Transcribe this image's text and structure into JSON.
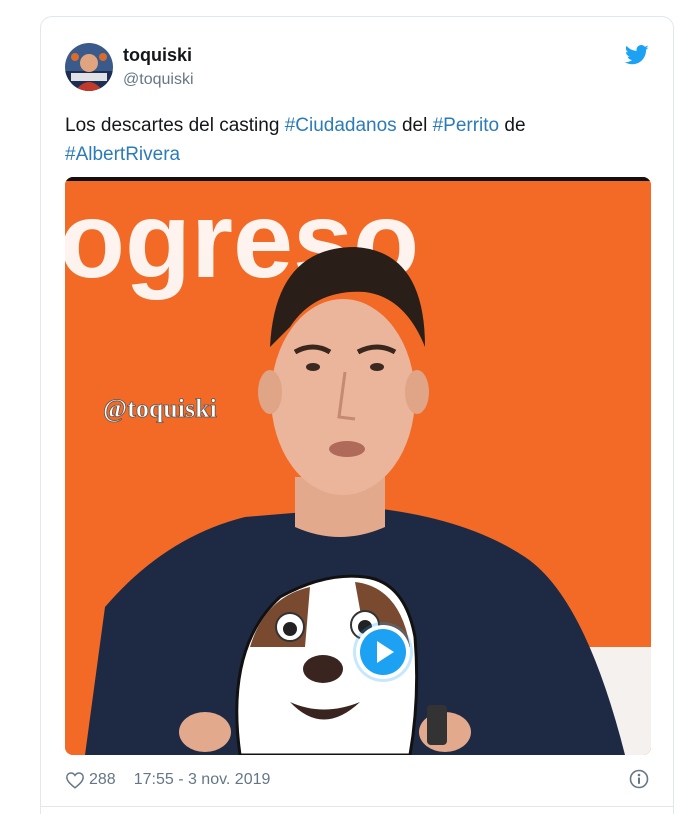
{
  "tweet": {
    "author_name": "toquiski",
    "author_handle": "@toquiski",
    "text_parts": [
      {
        "text": "Los descartes del casting ",
        "hashtag": false
      },
      {
        "text": "#Ciudadanos",
        "hashtag": true
      },
      {
        "text": " del ",
        "hashtag": false
      },
      {
        "text": "#Perrito",
        "hashtag": true
      },
      {
        "text": " de ",
        "hashtag": false
      },
      {
        "text": "#AlbertRivera",
        "hashtag": true
      }
    ],
    "media": {
      "overlay_top_text": "ogreso",
      "watermark": "@toquiski",
      "play_icon": "play-icon"
    },
    "likes": "288",
    "timestamp": "17:55 - 3 nov. 2019"
  },
  "icons": {
    "brand": "twitter-bird-icon",
    "like": "heart-icon",
    "info": "info-icon"
  },
  "colors": {
    "hashtag": "#2b7bb9",
    "twitter_blue": "#1da1f2",
    "media_background": "#f26a26",
    "muted_text": "#657786"
  }
}
